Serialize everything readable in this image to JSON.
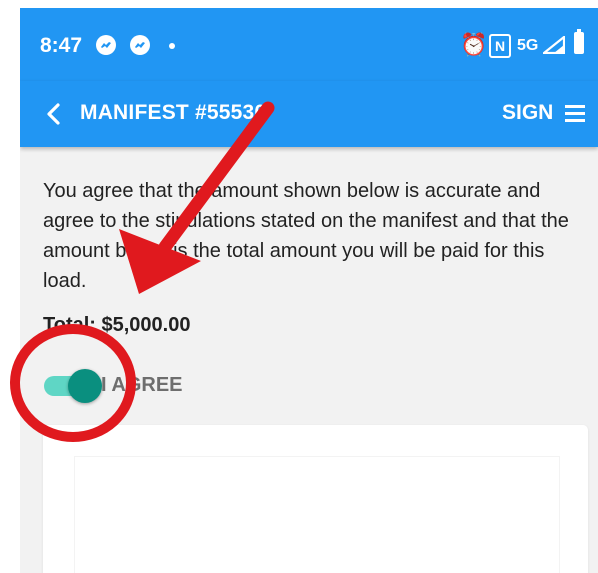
{
  "status": {
    "time": "8:47",
    "network": "5G",
    "icons": [
      "messenger-icon",
      "messenger-icon",
      "dot-icon",
      "alarm-icon",
      "nfc-icon",
      "signal-icon",
      "battery-icon"
    ]
  },
  "appbar": {
    "back_icon": "back-chevron-icon",
    "title": "MANIFEST #55530",
    "sign_label": "SIGN",
    "menu_icon": "hamburger-menu-icon"
  },
  "agreement": {
    "text": "You agree that the amount shown below is accurate and agree to the stipulations stated on the manifest and that the amount below is the total amount you will be paid for this load."
  },
  "total": {
    "text": "Total: $5,000.00"
  },
  "agree_toggle": {
    "label": "I AGREE",
    "checked": true
  },
  "colors": {
    "primary": "#2196f3",
    "toggle_on": "#0a8f7f",
    "annotation": "#e0191e"
  }
}
